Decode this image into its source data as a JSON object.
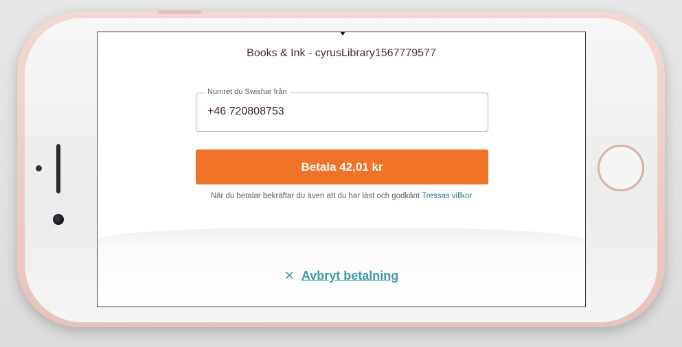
{
  "merchant": {
    "title": "Books & Ink - cyrusLibrary1567779577"
  },
  "phone_field": {
    "label": "Numret du Swishar från",
    "value": "+46 720808753"
  },
  "pay_button": {
    "label": "Betala 42,01 kr"
  },
  "terms": {
    "text": "När du betalar bekräftar du även att du har läst och godkänt",
    "link": "Tressas villkor"
  },
  "cancel": {
    "icon_glyph": "✕",
    "label": "Avbryt betalning"
  },
  "colors": {
    "accent": "#ee7326",
    "link": "#2b7a85",
    "cancel": "#3a9aa6"
  }
}
